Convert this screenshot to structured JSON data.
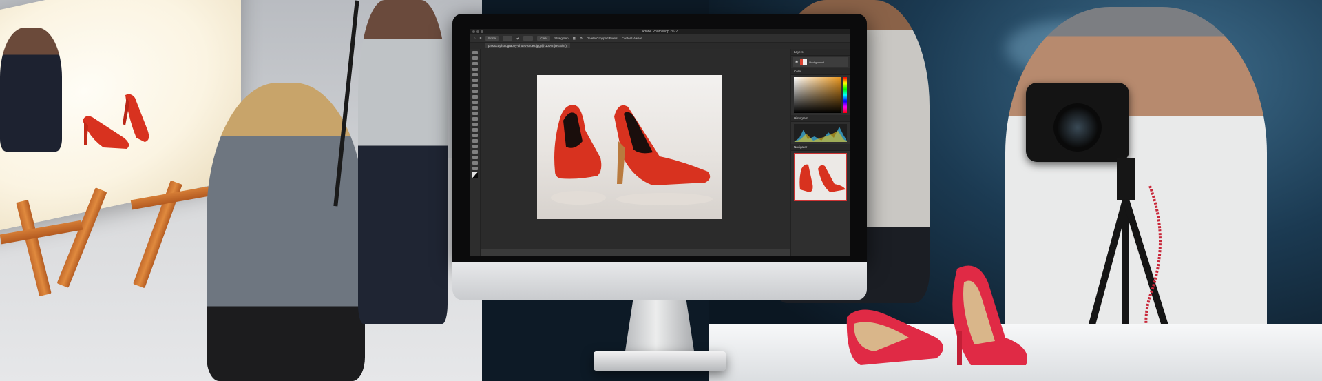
{
  "photoshop": {
    "window_title": "Adobe Photoshop 2022",
    "document_tab": "product-photography-shoes-shoes.jpg @ 100% (RGB/8*)",
    "options": {
      "preset": "None",
      "clear_label": "Clear",
      "straighten_label": "Straighten",
      "delete_cropped_label": "Delete Cropped Pixels",
      "content_aware_label": "Content-Aware"
    },
    "panels": {
      "layers_title": "Layers",
      "layer_name": "Background",
      "color_title": "Color",
      "histogram_title": "Histogram",
      "navigator_title": "Navigator"
    }
  },
  "colors": {
    "shoe_red": "#d8321f",
    "shoe_pink_red": "#e02a45",
    "table_wood": "#d27a36",
    "ps_dark": "#2b2b2b"
  }
}
